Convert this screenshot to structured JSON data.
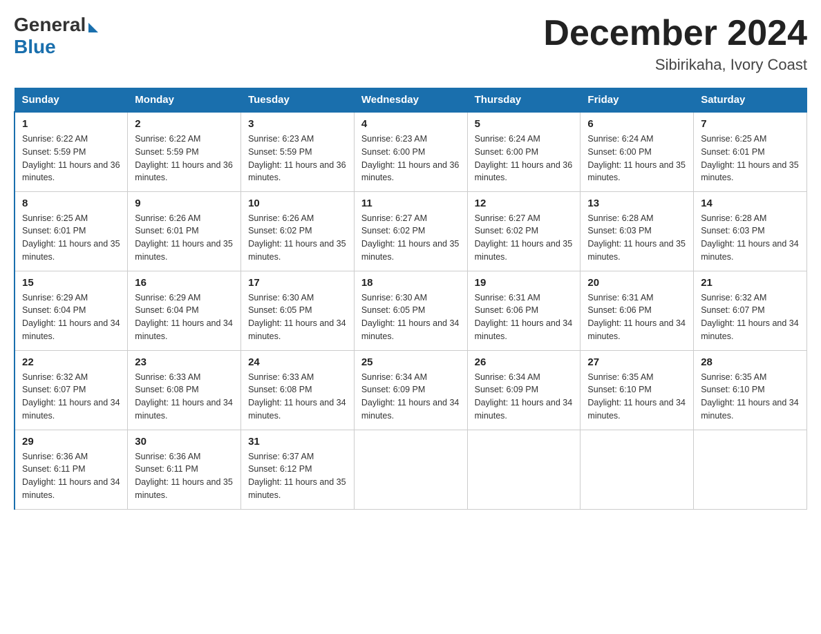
{
  "header": {
    "logo_general": "General",
    "logo_blue": "Blue",
    "month_title": "December 2024",
    "location": "Sibirikaha, Ivory Coast"
  },
  "days_of_week": [
    "Sunday",
    "Monday",
    "Tuesday",
    "Wednesday",
    "Thursday",
    "Friday",
    "Saturday"
  ],
  "weeks": [
    [
      {
        "num": "1",
        "sunrise": "6:22 AM",
        "sunset": "5:59 PM",
        "daylight": "11 hours and 36 minutes."
      },
      {
        "num": "2",
        "sunrise": "6:22 AM",
        "sunset": "5:59 PM",
        "daylight": "11 hours and 36 minutes."
      },
      {
        "num": "3",
        "sunrise": "6:23 AM",
        "sunset": "5:59 PM",
        "daylight": "11 hours and 36 minutes."
      },
      {
        "num": "4",
        "sunrise": "6:23 AM",
        "sunset": "6:00 PM",
        "daylight": "11 hours and 36 minutes."
      },
      {
        "num": "5",
        "sunrise": "6:24 AM",
        "sunset": "6:00 PM",
        "daylight": "11 hours and 36 minutes."
      },
      {
        "num": "6",
        "sunrise": "6:24 AM",
        "sunset": "6:00 PM",
        "daylight": "11 hours and 35 minutes."
      },
      {
        "num": "7",
        "sunrise": "6:25 AM",
        "sunset": "6:01 PM",
        "daylight": "11 hours and 35 minutes."
      }
    ],
    [
      {
        "num": "8",
        "sunrise": "6:25 AM",
        "sunset": "6:01 PM",
        "daylight": "11 hours and 35 minutes."
      },
      {
        "num": "9",
        "sunrise": "6:26 AM",
        "sunset": "6:01 PM",
        "daylight": "11 hours and 35 minutes."
      },
      {
        "num": "10",
        "sunrise": "6:26 AM",
        "sunset": "6:02 PM",
        "daylight": "11 hours and 35 minutes."
      },
      {
        "num": "11",
        "sunrise": "6:27 AM",
        "sunset": "6:02 PM",
        "daylight": "11 hours and 35 minutes."
      },
      {
        "num": "12",
        "sunrise": "6:27 AM",
        "sunset": "6:02 PM",
        "daylight": "11 hours and 35 minutes."
      },
      {
        "num": "13",
        "sunrise": "6:28 AM",
        "sunset": "6:03 PM",
        "daylight": "11 hours and 35 minutes."
      },
      {
        "num": "14",
        "sunrise": "6:28 AM",
        "sunset": "6:03 PM",
        "daylight": "11 hours and 34 minutes."
      }
    ],
    [
      {
        "num": "15",
        "sunrise": "6:29 AM",
        "sunset": "6:04 PM",
        "daylight": "11 hours and 34 minutes."
      },
      {
        "num": "16",
        "sunrise": "6:29 AM",
        "sunset": "6:04 PM",
        "daylight": "11 hours and 34 minutes."
      },
      {
        "num": "17",
        "sunrise": "6:30 AM",
        "sunset": "6:05 PM",
        "daylight": "11 hours and 34 minutes."
      },
      {
        "num": "18",
        "sunrise": "6:30 AM",
        "sunset": "6:05 PM",
        "daylight": "11 hours and 34 minutes."
      },
      {
        "num": "19",
        "sunrise": "6:31 AM",
        "sunset": "6:06 PM",
        "daylight": "11 hours and 34 minutes."
      },
      {
        "num": "20",
        "sunrise": "6:31 AM",
        "sunset": "6:06 PM",
        "daylight": "11 hours and 34 minutes."
      },
      {
        "num": "21",
        "sunrise": "6:32 AM",
        "sunset": "6:07 PM",
        "daylight": "11 hours and 34 minutes."
      }
    ],
    [
      {
        "num": "22",
        "sunrise": "6:32 AM",
        "sunset": "6:07 PM",
        "daylight": "11 hours and 34 minutes."
      },
      {
        "num": "23",
        "sunrise": "6:33 AM",
        "sunset": "6:08 PM",
        "daylight": "11 hours and 34 minutes."
      },
      {
        "num": "24",
        "sunrise": "6:33 AM",
        "sunset": "6:08 PM",
        "daylight": "11 hours and 34 minutes."
      },
      {
        "num": "25",
        "sunrise": "6:34 AM",
        "sunset": "6:09 PM",
        "daylight": "11 hours and 34 minutes."
      },
      {
        "num": "26",
        "sunrise": "6:34 AM",
        "sunset": "6:09 PM",
        "daylight": "11 hours and 34 minutes."
      },
      {
        "num": "27",
        "sunrise": "6:35 AM",
        "sunset": "6:10 PM",
        "daylight": "11 hours and 34 minutes."
      },
      {
        "num": "28",
        "sunrise": "6:35 AM",
        "sunset": "6:10 PM",
        "daylight": "11 hours and 34 minutes."
      }
    ],
    [
      {
        "num": "29",
        "sunrise": "6:36 AM",
        "sunset": "6:11 PM",
        "daylight": "11 hours and 34 minutes."
      },
      {
        "num": "30",
        "sunrise": "6:36 AM",
        "sunset": "6:11 PM",
        "daylight": "11 hours and 35 minutes."
      },
      {
        "num": "31",
        "sunrise": "6:37 AM",
        "sunset": "6:12 PM",
        "daylight": "11 hours and 35 minutes."
      },
      null,
      null,
      null,
      null
    ]
  ]
}
